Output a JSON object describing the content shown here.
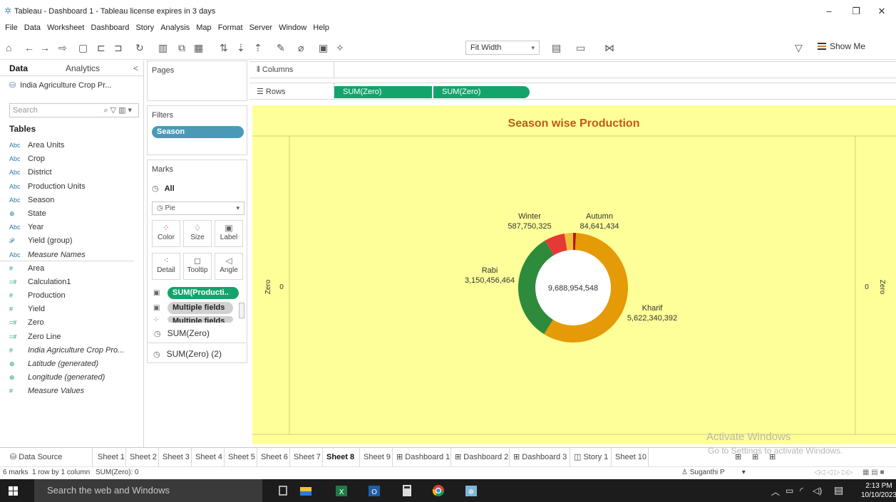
{
  "window": {
    "title": "Tableau - Dashboard 1 - Tableau license expires in 3 days",
    "minimize": "–",
    "restore": "❐",
    "close": "✕"
  },
  "menu": [
    "File",
    "Data",
    "Worksheet",
    "Dashboard",
    "Story",
    "Analysis",
    "Map",
    "Format",
    "Server",
    "Window",
    "Help"
  ],
  "toolbar": {
    "fit": "Fit Width",
    "show_me": "Show Me"
  },
  "data_pane": {
    "tab_data": "Data",
    "tab_analytics": "Analytics",
    "collapse": "<",
    "datasource": "India Agriculture Crop Pr...",
    "search_placeholder": "Search",
    "tables_heading": "Tables",
    "fields": [
      {
        "icon": "Abc",
        "name": "Area Units",
        "kind": "dim",
        "italic": false
      },
      {
        "icon": "Abc",
        "name": "Crop",
        "kind": "dim",
        "italic": false
      },
      {
        "icon": "Abc",
        "name": "District",
        "kind": "dim",
        "italic": false
      },
      {
        "icon": "Abc",
        "name": "Production Units",
        "kind": "dim",
        "italic": false
      },
      {
        "icon": "Abc",
        "name": "Season",
        "kind": "dim",
        "italic": false
      },
      {
        "icon": "⊕",
        "name": "State",
        "kind": "dim",
        "italic": false
      },
      {
        "icon": "Abc",
        "name": "Year",
        "kind": "dim",
        "italic": false
      },
      {
        "icon": "𝒫",
        "name": "Yield (group)",
        "kind": "dim",
        "italic": false
      },
      {
        "icon": "Abc",
        "name": "Measure Names",
        "kind": "dim",
        "italic": true
      },
      {
        "icon": "#",
        "name": "Area",
        "kind": "meas",
        "italic": false
      },
      {
        "icon": "=#",
        "name": "Calculation1",
        "kind": "meas",
        "italic": false
      },
      {
        "icon": "#",
        "name": "Production",
        "kind": "meas",
        "italic": false
      },
      {
        "icon": "#",
        "name": "Yield",
        "kind": "meas",
        "italic": false
      },
      {
        "icon": "=#",
        "name": "Zero",
        "kind": "meas",
        "italic": false
      },
      {
        "icon": "=#",
        "name": "Zero Line",
        "kind": "meas",
        "italic": false
      },
      {
        "icon": "#",
        "name": "India Agriculture Crop Pro...",
        "kind": "meas",
        "italic": true
      },
      {
        "icon": "⊕",
        "name": "Latitude (generated)",
        "kind": "meas",
        "italic": true
      },
      {
        "icon": "⊕",
        "name": "Longitude (generated)",
        "kind": "meas",
        "italic": true
      },
      {
        "icon": "#",
        "name": "Measure Values",
        "kind": "meas",
        "italic": true
      }
    ]
  },
  "cards": {
    "pages": "Pages",
    "filters": "Filters",
    "filter_pill": "Season",
    "marks": "Marks",
    "all": "All",
    "mark_type": "Pie",
    "buttons": {
      "color": "Color",
      "size": "Size",
      "label": "Label",
      "detail": "Detail",
      "tooltip": "Tooltip",
      "angle": "Angle"
    },
    "pill_production": "SUM(Producti..",
    "pill_multiple": "Multiple fields",
    "pill_multiple2": "Multiple fields",
    "sum_zero": "SUM(Zero)",
    "sum_zero_2": "SUM(Zero) (2)"
  },
  "shelves": {
    "columns": "Columns",
    "rows": "Rows",
    "row_pill_1": "SUM(Zero)",
    "row_pill_2": "SUM(Zero)"
  },
  "viz": {
    "axis_left": "Zero",
    "axis_right": "Zero",
    "axis_zero_left": "0",
    "axis_zero_right": "0",
    "background": "#ffff99",
    "title_color": "#c05a17"
  },
  "chart_data": {
    "type": "pie",
    "title": "Season wise Production",
    "total_label": "9,688,954,548",
    "slices": [
      {
        "name": "Autumn",
        "value": 84641434,
        "label": "84,641,434",
        "color": "#b71c1c"
      },
      {
        "name": "Kharif",
        "value": 5622340392,
        "label": "5,622,340,392",
        "color": "#e59a07"
      },
      {
        "name": "Rabi",
        "value": 3150456464,
        "label": "3,150,456,464",
        "color": "#2e8b3b"
      },
      {
        "name": "Winter",
        "value": 587750325,
        "label": "587,750,325",
        "color": "#e53935"
      },
      {
        "name": "",
        "value": 244000000,
        "label": "",
        "color": "#f2bd3c"
      }
    ]
  },
  "sheet_tabs": {
    "data_source": "Data Source",
    "tabs": [
      "Sheet 1",
      "Sheet 2",
      "Sheet 3",
      "Sheet 4",
      "Sheet 5",
      "Sheet 6",
      "Sheet 7",
      "Sheet 8",
      "Sheet 9",
      "Dashboard 1",
      "Dashboard 2",
      "Dashboard 3",
      "Story 1",
      "Sheet 10"
    ],
    "active": "Sheet 8"
  },
  "activate": {
    "line1": "Activate Windows",
    "line2": "Go to Settings to activate Windows."
  },
  "status": {
    "marks": "6 marks",
    "dims": "1 row by 1 column",
    "sum": "SUM(Zero): 0",
    "user": "Suganthi P"
  },
  "taskbar": {
    "search": "Search the web and Windows",
    "time": "2:13 PM",
    "date": "10/10/2023"
  }
}
